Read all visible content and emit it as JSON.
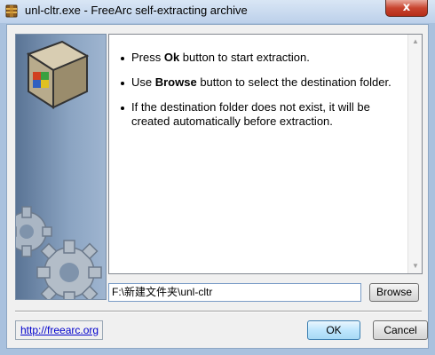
{
  "window": {
    "title": "unl-cltr.exe - FreeArc self-extracting archive",
    "close_glyph": "x"
  },
  "messages": [
    {
      "before": "Press ",
      "bold": "Ok",
      "after": " button to start extraction."
    },
    {
      "before": "Use ",
      "bold": "Browse",
      "after": " button to select the destination folder."
    },
    {
      "before": "If the destination folder does not exist, it will be created automatically before extraction.",
      "bold": "",
      "after": ""
    }
  ],
  "destination": {
    "path": "F:\\新建文件夹\\unl-cltr"
  },
  "buttons": {
    "browse": "Browse",
    "ok": "OK",
    "cancel": "Cancel"
  },
  "footer": {
    "link": "http://freearc.org"
  },
  "icons": {
    "app": "archive-box-icon",
    "side_art": "gears-and-box-icon"
  },
  "colors": {
    "close": "#c8442f",
    "link": "#0000cc",
    "ok_border": "#3c7fb1"
  }
}
